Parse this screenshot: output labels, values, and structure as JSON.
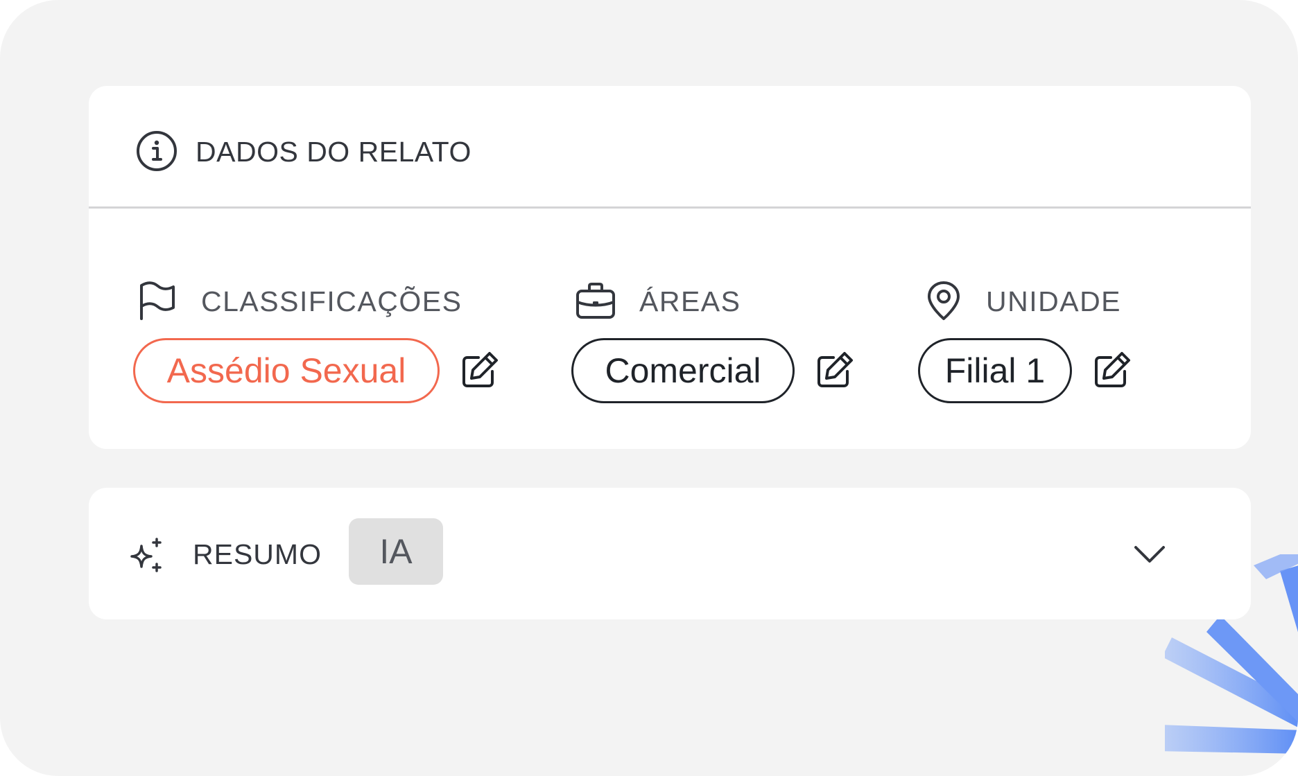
{
  "report": {
    "title": "DADOS DO RELATO",
    "fields": [
      {
        "label": "CLASSIFICAÇÕES",
        "icon": "flag-icon",
        "value": "Assédio Sexual",
        "tone": "alert",
        "color": "#F2684E"
      },
      {
        "label": "ÁREAS",
        "icon": "briefcase-icon",
        "value": "Comercial",
        "tone": "default",
        "color": "#1F2329"
      },
      {
        "label": "UNIDADE",
        "icon": "map-pin-icon",
        "value": "Filial 1",
        "tone": "default",
        "color": "#1F2329"
      }
    ]
  },
  "summary": {
    "label": "RESUMO",
    "badge": "IA",
    "icon": "sparkles-icon",
    "toggle_icon": "chevron-down-icon"
  },
  "colors": {
    "background": "#F3F3F3",
    "card": "#FFFFFF",
    "accent_burst": "#5B8CF5"
  }
}
